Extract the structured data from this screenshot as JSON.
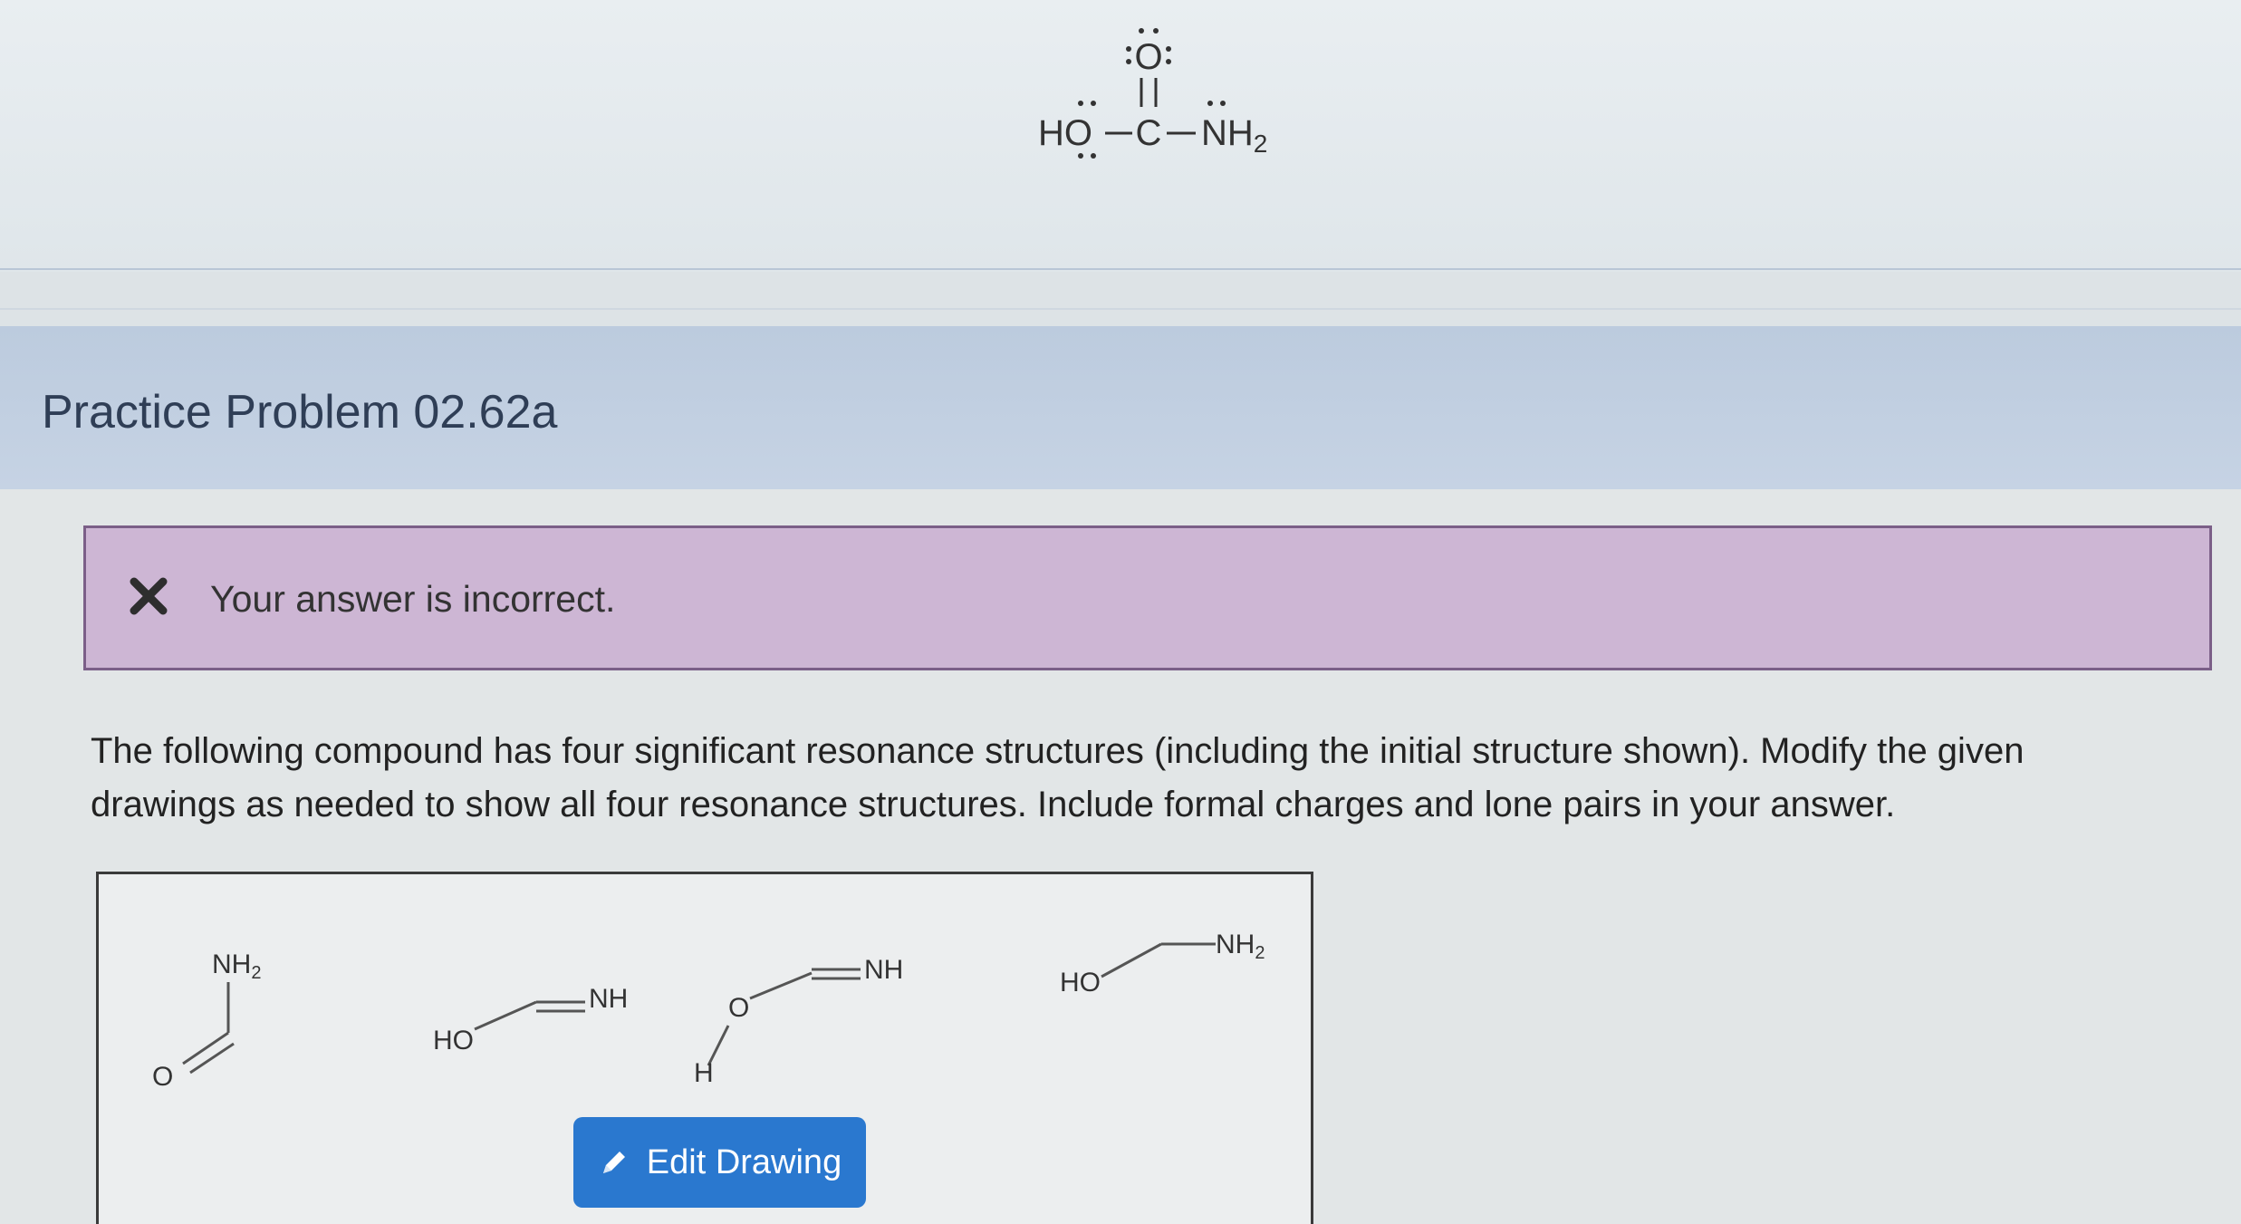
{
  "structure": {
    "left_group": "HO",
    "center_atom": "C",
    "top_atom": "O",
    "right_group": "NH",
    "right_subscript": "2"
  },
  "header": {
    "title": "Practice Problem 02.62a"
  },
  "feedback": {
    "icon": "x-icon",
    "message": "Your answer is incorrect.",
    "color": "#cdb6d4"
  },
  "question": {
    "text": "The following compound has four significant resonance structures (including the initial structure shown). Modify the given drawings as needed to show all four resonance structures. Include formal charges and lone pairs in your answer."
  },
  "drawings": {
    "d1": {
      "top_label": "NH",
      "top_sub": "2",
      "bottom_label": "O"
    },
    "d2": {
      "left_label": "HO",
      "right_label": "NH"
    },
    "d3": {
      "o_label": "O",
      "h_label": "H",
      "right_label": "NH"
    },
    "d4": {
      "left_label": "HO",
      "right_label": "NH",
      "right_sub": "2"
    }
  },
  "edit_button": {
    "label": "Edit Drawing",
    "icon": "pencil-icon",
    "color": "#2a78cf"
  }
}
